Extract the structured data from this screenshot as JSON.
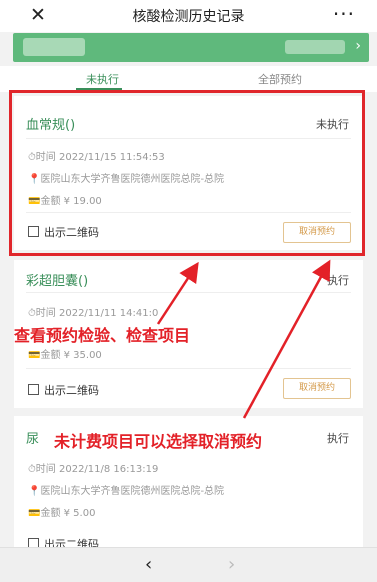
{
  "header": {
    "close_icon": "close-icon",
    "title": "核酸检测历史记录",
    "more_icon": "more-icon"
  },
  "banner": {
    "chevron": "›",
    "color": "#5fb97c"
  },
  "tabs": [
    {
      "label": "未执行",
      "active": true
    },
    {
      "label": "全部预约",
      "active": false
    }
  ],
  "records": [
    {
      "name": "血常规()",
      "status": "未执行",
      "time": "⏱时间 2022/11/15 11:54:53",
      "hospital": "📍医院山东大学齐鲁医院德州医院总院-总院",
      "amount": "💳金额 ¥ 19.00",
      "qr_label": "出示二维码",
      "cancel_label": "取消预约"
    },
    {
      "name": "彩超胆囊()",
      "status": "执行",
      "time": "⏱时间 2022/11/11 14:41:0",
      "hospital": "",
      "amount": "💳金额 ¥ 35.00",
      "qr_label": "出示二维码",
      "cancel_label": "取消预约"
    },
    {
      "name": "尿",
      "status": "执行",
      "time": "⏱时间 2022/11/8 16:13:19",
      "hospital": "📍医院山东大学齐鲁医院德州医院总院-总院",
      "amount": "💳金额 ¥ 5.00",
      "qr_label": "出示二维码",
      "cancel_label": ""
    }
  ],
  "annotations": {
    "first": "查看预约检验、检查项目",
    "second": "未计费项目可以选择取消预约",
    "color": "#e32128"
  },
  "bottom": {
    "back": "‹",
    "forward": "›"
  }
}
